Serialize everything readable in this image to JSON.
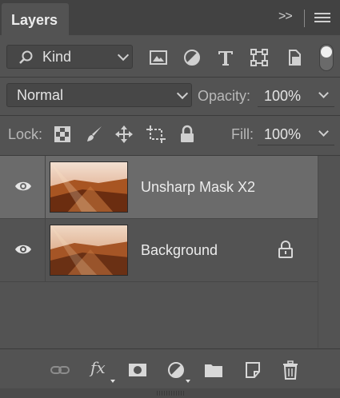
{
  "panel": {
    "title": "Layers",
    "collapse_glyph": ">>"
  },
  "filter": {
    "kind_label": "Kind"
  },
  "blend": {
    "mode": "Normal",
    "opacity_label": "Opacity:",
    "opacity_value": "100%"
  },
  "lock": {
    "label": "Lock:",
    "fill_label": "Fill:",
    "fill_value": "100%"
  },
  "layers": [
    {
      "name": "Unsharp Mask X2",
      "visible": true,
      "selected": true,
      "locked": false
    },
    {
      "name": "Background",
      "visible": true,
      "selected": false,
      "locked": true
    }
  ],
  "footer": {
    "fx_label": "fx"
  },
  "colors": {
    "panel_bg": "#535353",
    "header_bg": "#424242",
    "selected_row": "#6b6b6b",
    "text": "#ececec"
  }
}
